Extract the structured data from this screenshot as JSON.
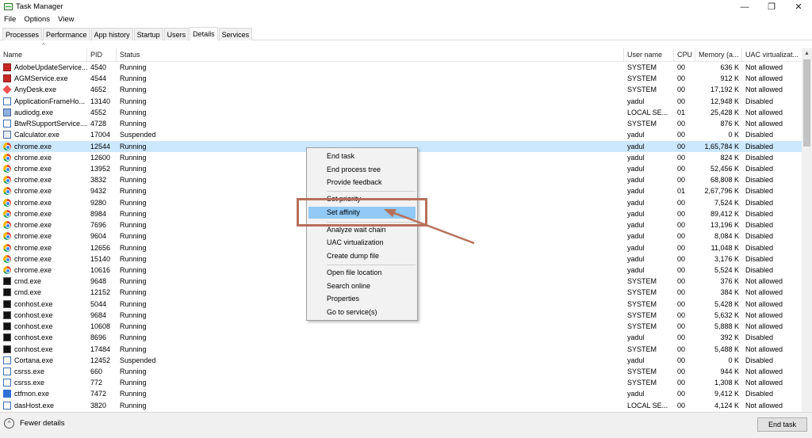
{
  "window": {
    "title": "Task Manager",
    "controls": [
      "—",
      "❐",
      "✕"
    ]
  },
  "menu": [
    "File",
    "Options",
    "View"
  ],
  "tabs": [
    "Processes",
    "Performance",
    "App history",
    "Startup",
    "Users",
    "Details",
    "Services"
  ],
  "active_tab": "Details",
  "columns": [
    "Name",
    "PID",
    "Status",
    "User name",
    "CPU",
    "Memory (a...",
    "UAC virtualizat..."
  ],
  "processes": [
    {
      "name": "AdobeUpdateService...",
      "pid": "4540",
      "status": "Running",
      "user": "SYSTEM",
      "cpu": "00",
      "memory": "636 K",
      "uac": "Not allowed",
      "icon": "adobe-icon"
    },
    {
      "name": "AGMService.exe",
      "pid": "4544",
      "status": "Running",
      "user": "SYSTEM",
      "cpu": "00",
      "memory": "912 K",
      "uac": "Not allowed",
      "icon": "agm-icon"
    },
    {
      "name": "AnyDesk.exe",
      "pid": "4652",
      "status": "Running",
      "user": "SYSTEM",
      "cpu": "00",
      "memory": "17,192 K",
      "uac": "Not allowed",
      "icon": "anydesk-icon"
    },
    {
      "name": "ApplicationFrameHo...",
      "pid": "13140",
      "status": "Running",
      "user": "yadul",
      "cpu": "00",
      "memory": "12,948 K",
      "uac": "Disabled",
      "icon": "window-icon"
    },
    {
      "name": "audiodg.exe",
      "pid": "4552",
      "status": "Running",
      "user": "LOCAL SE...",
      "cpu": "01",
      "memory": "25,428 K",
      "uac": "Not allowed",
      "icon": "service-icon"
    },
    {
      "name": "BtwRSupportService....",
      "pid": "4728",
      "status": "Running",
      "user": "SYSTEM",
      "cpu": "00",
      "memory": "876 K",
      "uac": "Not allowed",
      "icon": "window-icon"
    },
    {
      "name": "Calculator.exe",
      "pid": "17004",
      "status": "Suspended",
      "user": "yadul",
      "cpu": "00",
      "memory": "0 K",
      "uac": "Disabled",
      "icon": "calculator-icon"
    },
    {
      "name": "chrome.exe",
      "pid": "12544",
      "status": "Running",
      "user": "yadul",
      "cpu": "00",
      "memory": "1,65,784 K",
      "uac": "Disabled",
      "icon": "chrome-icon"
    },
    {
      "name": "chrome.exe",
      "pid": "12600",
      "status": "Running",
      "user": "yadul",
      "cpu": "00",
      "memory": "824 K",
      "uac": "Disabled",
      "icon": "chrome-icon"
    },
    {
      "name": "chrome.exe",
      "pid": "13952",
      "status": "Running",
      "user": "yadul",
      "cpu": "00",
      "memory": "52,456 K",
      "uac": "Disabled",
      "icon": "chrome-icon"
    },
    {
      "name": "chrome.exe",
      "pid": "3832",
      "status": "Running",
      "user": "yadul",
      "cpu": "00",
      "memory": "68,808 K",
      "uac": "Disabled",
      "icon": "chrome-icon"
    },
    {
      "name": "chrome.exe",
      "pid": "9432",
      "status": "Running",
      "user": "yadul",
      "cpu": "01",
      "memory": "2,67,796 K",
      "uac": "Disabled",
      "icon": "chrome-icon"
    },
    {
      "name": "chrome.exe",
      "pid": "9280",
      "status": "Running",
      "user": "yadul",
      "cpu": "00",
      "memory": "7,524 K",
      "uac": "Disabled",
      "icon": "chrome-icon"
    },
    {
      "name": "chrome.exe",
      "pid": "8984",
      "status": "Running",
      "user": "yadul",
      "cpu": "00",
      "memory": "89,412 K",
      "uac": "Disabled",
      "icon": "chrome-icon"
    },
    {
      "name": "chrome.exe",
      "pid": "7696",
      "status": "Running",
      "user": "yadul",
      "cpu": "00",
      "memory": "13,196 K",
      "uac": "Disabled",
      "icon": "chrome-icon"
    },
    {
      "name": "chrome.exe",
      "pid": "9604",
      "status": "Running",
      "user": "yadul",
      "cpu": "00",
      "memory": "8,084 K",
      "uac": "Disabled",
      "icon": "chrome-icon"
    },
    {
      "name": "chrome.exe",
      "pid": "12656",
      "status": "Running",
      "user": "yadul",
      "cpu": "00",
      "memory": "11,048 K",
      "uac": "Disabled",
      "icon": "chrome-icon"
    },
    {
      "name": "chrome.exe",
      "pid": "15140",
      "status": "Running",
      "user": "yadul",
      "cpu": "00",
      "memory": "3,176 K",
      "uac": "Disabled",
      "icon": "chrome-icon"
    },
    {
      "name": "chrome.exe",
      "pid": "10616",
      "status": "Running",
      "user": "yadul",
      "cpu": "00",
      "memory": "5,524 K",
      "uac": "Disabled",
      "icon": "chrome-icon"
    },
    {
      "name": "cmd.exe",
      "pid": "9648",
      "status": "Running",
      "user": "SYSTEM",
      "cpu": "00",
      "memory": "376 K",
      "uac": "Not allowed",
      "icon": "cmd-icon"
    },
    {
      "name": "cmd.exe",
      "pid": "12152",
      "status": "Running",
      "user": "SYSTEM",
      "cpu": "00",
      "memory": "384 K",
      "uac": "Not allowed",
      "icon": "cmd-icon"
    },
    {
      "name": "conhost.exe",
      "pid": "5044",
      "status": "Running",
      "user": "SYSTEM",
      "cpu": "00",
      "memory": "5,428 K",
      "uac": "Not allowed",
      "icon": "cmd-icon"
    },
    {
      "name": "conhost.exe",
      "pid": "9684",
      "status": "Running",
      "user": "SYSTEM",
      "cpu": "00",
      "memory": "5,632 K",
      "uac": "Not allowed",
      "icon": "cmd-icon"
    },
    {
      "name": "conhost.exe",
      "pid": "10608",
      "status": "Running",
      "user": "SYSTEM",
      "cpu": "00",
      "memory": "5,888 K",
      "uac": "Not allowed",
      "icon": "cmd-icon"
    },
    {
      "name": "conhost.exe",
      "pid": "8696",
      "status": "Running",
      "user": "yadul",
      "cpu": "00",
      "memory": "392 K",
      "uac": "Disabled",
      "icon": "cmd-icon"
    },
    {
      "name": "conhost.exe",
      "pid": "17484",
      "status": "Running",
      "user": "SYSTEM",
      "cpu": "00",
      "memory": "5,488 K",
      "uac": "Not allowed",
      "icon": "cmd-icon"
    },
    {
      "name": "Cortana.exe",
      "pid": "12452",
      "status": "Suspended",
      "user": "yadul",
      "cpu": "00",
      "memory": "0 K",
      "uac": "Disabled",
      "icon": "cortana-icon"
    },
    {
      "name": "csrss.exe",
      "pid": "660",
      "status": "Running",
      "user": "SYSTEM",
      "cpu": "00",
      "memory": "944 K",
      "uac": "Not allowed",
      "icon": "window-icon"
    },
    {
      "name": "csrss.exe",
      "pid": "772",
      "status": "Running",
      "user": "SYSTEM",
      "cpu": "00",
      "memory": "1,308 K",
      "uac": "Not allowed",
      "icon": "window-icon"
    },
    {
      "name": "ctfmon.exe",
      "pid": "7472",
      "status": "Running",
      "user": "yadul",
      "cpu": "00",
      "memory": "9,412 K",
      "uac": "Disabled",
      "icon": "ctfmon-icon"
    },
    {
      "name": "dasHost.exe",
      "pid": "3820",
      "status": "Running",
      "user": "LOCAL SE...",
      "cpu": "00",
      "memory": "4,124 K",
      "uac": "Not allowed",
      "icon": "window-icon"
    }
  ],
  "selected_row": 7,
  "context_menu": {
    "items": [
      "End task",
      "End process tree",
      "Provide feedback",
      "Set priority",
      "Set affinity",
      "Analyze wait chain",
      "UAC virtualization",
      "Create dump file",
      "Open file location",
      "Search online",
      "Properties",
      "Go to service(s)"
    ],
    "highlighted": "Set affinity",
    "submenu_arrow": "›"
  },
  "footer": {
    "fewer_details": "Fewer details",
    "fewer_icon": "^",
    "end_task": "End task"
  },
  "colors": {
    "selection": "#cce8ff",
    "menu_highlight": "#91c9f7",
    "annotation": "#b7705a"
  }
}
